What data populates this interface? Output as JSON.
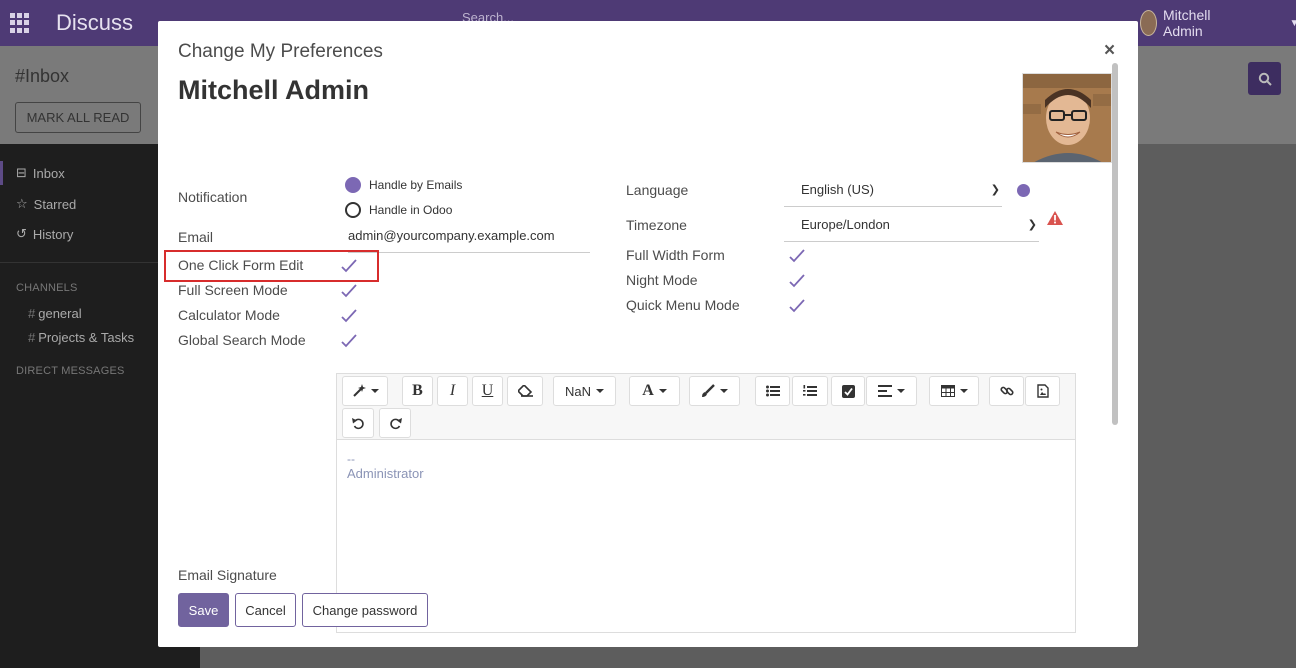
{
  "navbar": {
    "app_name": "Discuss",
    "search_placeholder": "Search...",
    "user_name": "Mitchell Admin"
  },
  "control_panel": {
    "title": "#Inbox",
    "mark_all_read": "MARK ALL READ"
  },
  "sidebar": {
    "items": [
      {
        "label": "Inbox",
        "icon": "inbox-icon"
      },
      {
        "label": "Starred",
        "icon": "star-icon"
      },
      {
        "label": "History",
        "icon": "history-icon"
      }
    ],
    "channels_heading": "CHANNELS",
    "channels": [
      "general",
      "Projects & Tasks"
    ],
    "direct_messages_heading": "DIRECT MESSAGES"
  },
  "modal": {
    "title": "Change My Preferences",
    "close": "×",
    "user_name": "Mitchell Admin",
    "fields": {
      "notification_label": "Notification",
      "notification_options": [
        "Handle by Emails",
        "Handle in Odoo"
      ],
      "notification_selected": "Handle by Emails",
      "email_label": "Email",
      "email_value": "admin@yourcompany.example.com",
      "one_click_label": "One Click Form Edit",
      "full_screen_label": "Full Screen Mode",
      "calculator_label": "Calculator Mode",
      "global_search_label": "Global Search Mode",
      "language_label": "Language",
      "language_value": "English (US)",
      "timezone_label": "Timezone",
      "timezone_value": "Europe/London",
      "full_width_label": "Full Width Form",
      "night_mode_label": "Night Mode",
      "quick_menu_label": "Quick Menu Mode",
      "email_signature_label": "Email Signature"
    },
    "editor": {
      "font_size": "NaN",
      "font_color_glyph": "A",
      "bold_glyph": "B",
      "italic_glyph": "I",
      "underline_glyph": "U",
      "signature_dash": "--",
      "signature_text": "Administrator"
    },
    "buttons": {
      "save": "Save",
      "cancel": "Cancel",
      "change_password": "Change password"
    }
  },
  "colors": {
    "navbar": "#4e3a75",
    "accent": "#7c68b4",
    "primary_button": "#71639e",
    "highlight_border": "#d72c2c",
    "warning": "#d9534f"
  }
}
